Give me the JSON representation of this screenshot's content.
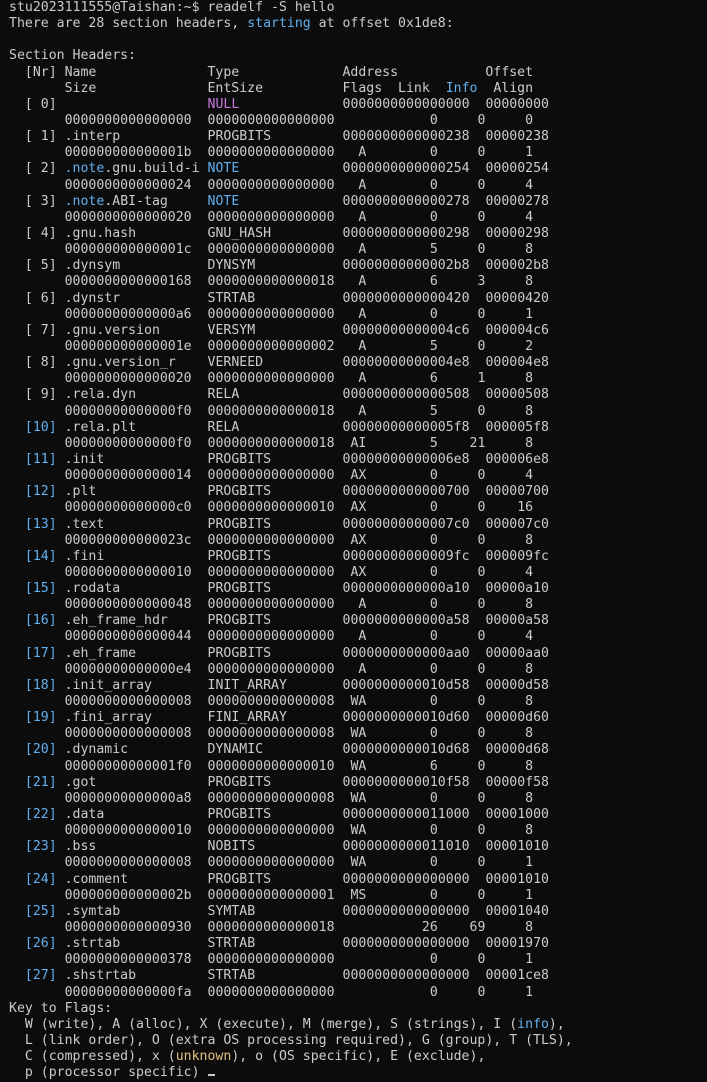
{
  "prompt": "stu2023111555@Taishan:~$ readelf -S hello",
  "intro": {
    "before": "There are 28 section headers, ",
    "word": "starting",
    "after": " at offset 0x1de8:"
  },
  "title": "Section Headers:",
  "header1": {
    "a": "  [Nr] Name              Type             Address           Offset"
  },
  "header2": {
    "a": "       Size              EntSize          Flags  Link  ",
    "info": "Info",
    "b": "  Align"
  },
  "sections": [
    {
      "nr": "[ 0]",
      "name": "",
      "type": "NULL",
      "addr": "0000000000000000",
      "off": "00000000",
      "size": "0000000000000000",
      "ent": "0000000000000000",
      "flags": "",
      "link": "0",
      "info": "0",
      "align": "0"
    },
    {
      "nr": "[ 1]",
      "name": ".interp",
      "type": "PROGBITS",
      "addr": "0000000000000238",
      "off": "00000238",
      "size": "000000000000001b",
      "ent": "0000000000000000",
      "flags": "A",
      "link": "0",
      "info": "0",
      "align": "1"
    },
    {
      "nr": "[ 2]",
      "name": ".note.gnu.build-i",
      "type": "NOTE",
      "addr": "0000000000000254",
      "off": "00000254",
      "size": "0000000000000024",
      "ent": "0000000000000000",
      "flags": "A",
      "link": "0",
      "info": "0",
      "align": "4"
    },
    {
      "nr": "[ 3]",
      "name": ".note.ABI-tag",
      "type": "NOTE",
      "addr": "0000000000000278",
      "off": "00000278",
      "size": "0000000000000020",
      "ent": "0000000000000000",
      "flags": "A",
      "link": "0",
      "info": "0",
      "align": "4"
    },
    {
      "nr": "[ 4]",
      "name": ".gnu.hash",
      "type": "GNU_HASH",
      "addr": "0000000000000298",
      "off": "00000298",
      "size": "000000000000001c",
      "ent": "0000000000000000",
      "flags": "A",
      "link": "5",
      "info": "0",
      "align": "8"
    },
    {
      "nr": "[ 5]",
      "name": ".dynsym",
      "type": "DYNSYM",
      "addr": "00000000000002b8",
      "off": "000002b8",
      "size": "0000000000000168",
      "ent": "0000000000000018",
      "flags": "A",
      "link": "6",
      "info": "3",
      "align": "8"
    },
    {
      "nr": "[ 6]",
      "name": ".dynstr",
      "type": "STRTAB",
      "addr": "0000000000000420",
      "off": "00000420",
      "size": "00000000000000a6",
      "ent": "0000000000000000",
      "flags": "A",
      "link": "0",
      "info": "0",
      "align": "1"
    },
    {
      "nr": "[ 7]",
      "name": ".gnu.version",
      "type": "VERSYM",
      "addr": "00000000000004c6",
      "off": "000004c6",
      "size": "000000000000001e",
      "ent": "0000000000000002",
      "flags": "A",
      "link": "5",
      "info": "0",
      "align": "2"
    },
    {
      "nr": "[ 8]",
      "name": ".gnu.version_r",
      "type": "VERNEED",
      "addr": "00000000000004e8",
      "off": "000004e8",
      "size": "0000000000000020",
      "ent": "0000000000000000",
      "flags": "A",
      "link": "6",
      "info": "1",
      "align": "8"
    },
    {
      "nr": "[ 9]",
      "name": ".rela.dyn",
      "type": "RELA",
      "addr": "0000000000000508",
      "off": "00000508",
      "size": "00000000000000f0",
      "ent": "0000000000000018",
      "flags": "A",
      "link": "5",
      "info": "0",
      "align": "8"
    },
    {
      "nr": "[10]",
      "name": ".rela.plt",
      "type": "RELA",
      "addr": "00000000000005f8",
      "off": "000005f8",
      "size": "00000000000000f0",
      "ent": "0000000000000018",
      "flags": "AI",
      "link": "5",
      "info": "21",
      "align": "8"
    },
    {
      "nr": "[11]",
      "name": ".init",
      "type": "PROGBITS",
      "addr": "00000000000006e8",
      "off": "000006e8",
      "size": "0000000000000014",
      "ent": "0000000000000000",
      "flags": "AX",
      "link": "0",
      "info": "0",
      "align": "4"
    },
    {
      "nr": "[12]",
      "name": ".plt",
      "type": "PROGBITS",
      "addr": "0000000000000700",
      "off": "00000700",
      "size": "00000000000000c0",
      "ent": "0000000000000010",
      "flags": "AX",
      "link": "0",
      "info": "0",
      "align": "16"
    },
    {
      "nr": "[13]",
      "name": ".text",
      "type": "PROGBITS",
      "addr": "00000000000007c0",
      "off": "000007c0",
      "size": "000000000000023c",
      "ent": "0000000000000000",
      "flags": "AX",
      "link": "0",
      "info": "0",
      "align": "8"
    },
    {
      "nr": "[14]",
      "name": ".fini",
      "type": "PROGBITS",
      "addr": "00000000000009fc",
      "off": "000009fc",
      "size": "0000000000000010",
      "ent": "0000000000000000",
      "flags": "AX",
      "link": "0",
      "info": "0",
      "align": "4"
    },
    {
      "nr": "[15]",
      "name": ".rodata",
      "type": "PROGBITS",
      "addr": "0000000000000a10",
      "off": "00000a10",
      "size": "0000000000000048",
      "ent": "0000000000000000",
      "flags": "A",
      "link": "0",
      "info": "0",
      "align": "8"
    },
    {
      "nr": "[16]",
      "name": ".eh_frame_hdr",
      "type": "PROGBITS",
      "addr": "0000000000000a58",
      "off": "00000a58",
      "size": "0000000000000044",
      "ent": "0000000000000000",
      "flags": "A",
      "link": "0",
      "info": "0",
      "align": "4"
    },
    {
      "nr": "[17]",
      "name": ".eh_frame",
      "type": "PROGBITS",
      "addr": "0000000000000aa0",
      "off": "00000aa0",
      "size": "00000000000000e4",
      "ent": "0000000000000000",
      "flags": "A",
      "link": "0",
      "info": "0",
      "align": "8"
    },
    {
      "nr": "[18]",
      "name": ".init_array",
      "type": "INIT_ARRAY",
      "addr": "0000000000010d58",
      "off": "00000d58",
      "size": "0000000000000008",
      "ent": "0000000000000008",
      "flags": "WA",
      "link": "0",
      "info": "0",
      "align": "8"
    },
    {
      "nr": "[19]",
      "name": ".fini_array",
      "type": "FINI_ARRAY",
      "addr": "0000000000010d60",
      "off": "00000d60",
      "size": "0000000000000008",
      "ent": "0000000000000008",
      "flags": "WA",
      "link": "0",
      "info": "0",
      "align": "8"
    },
    {
      "nr": "[20]",
      "name": ".dynamic",
      "type": "DYNAMIC",
      "addr": "0000000000010d68",
      "off": "00000d68",
      "size": "00000000000001f0",
      "ent": "0000000000000010",
      "flags": "WA",
      "link": "6",
      "info": "0",
      "align": "8"
    },
    {
      "nr": "[21]",
      "name": ".got",
      "type": "PROGBITS",
      "addr": "0000000000010f58",
      "off": "00000f58",
      "size": "00000000000000a8",
      "ent": "0000000000000008",
      "flags": "WA",
      "link": "0",
      "info": "0",
      "align": "8"
    },
    {
      "nr": "[22]",
      "name": ".data",
      "type": "PROGBITS",
      "addr": "0000000000011000",
      "off": "00001000",
      "size": "0000000000000010",
      "ent": "0000000000000000",
      "flags": "WA",
      "link": "0",
      "info": "0",
      "align": "8"
    },
    {
      "nr": "[23]",
      "name": ".bss",
      "type": "NOBITS",
      "addr": "0000000000011010",
      "off": "00001010",
      "size": "0000000000000008",
      "ent": "0000000000000000",
      "flags": "WA",
      "link": "0",
      "info": "0",
      "align": "1"
    },
    {
      "nr": "[24]",
      "name": ".comment",
      "type": "PROGBITS",
      "addr": "0000000000000000",
      "off": "00001010",
      "size": "000000000000002b",
      "ent": "0000000000000001",
      "flags": "MS",
      "link": "0",
      "info": "0",
      "align": "1"
    },
    {
      "nr": "[25]",
      "name": ".symtab",
      "type": "SYMTAB",
      "addr": "0000000000000000",
      "off": "00001040",
      "size": "0000000000000930",
      "ent": "0000000000000018",
      "flags": "",
      "link": "26",
      "info": "69",
      "align": "8"
    },
    {
      "nr": "[26]",
      "name": ".strtab",
      "type": "STRTAB",
      "addr": "0000000000000000",
      "off": "00001970",
      "size": "0000000000000378",
      "ent": "0000000000000000",
      "flags": "",
      "link": "0",
      "info": "0",
      "align": "1"
    },
    {
      "nr": "[27]",
      "name": ".shstrtab",
      "type": "STRTAB",
      "addr": "0000000000000000",
      "off": "00001ce8",
      "size": "00000000000000fa",
      "ent": "0000000000000000",
      "flags": "",
      "link": "0",
      "info": "0",
      "align": "1"
    }
  ],
  "key_title": "Key to Flags:",
  "key1": {
    "a": "  W (write), A (alloc), X (execute), M (merge), S (strings), I (",
    "info": "info",
    "b": "),"
  },
  "key2": "  L (link order), O (extra OS processing required), G (group), T (TLS),",
  "key3": {
    "a": "  C (compressed), x (",
    "unknown": "unknown",
    "b": "), o (OS specific), E (exclude),"
  },
  "key4": "  p (processor specific)",
  "colors": {
    "background": "#0c0c0c",
    "text": "#cccccc",
    "blue": "#61afef",
    "magenta": "#c678dd",
    "yellow": "#e5c07b"
  }
}
